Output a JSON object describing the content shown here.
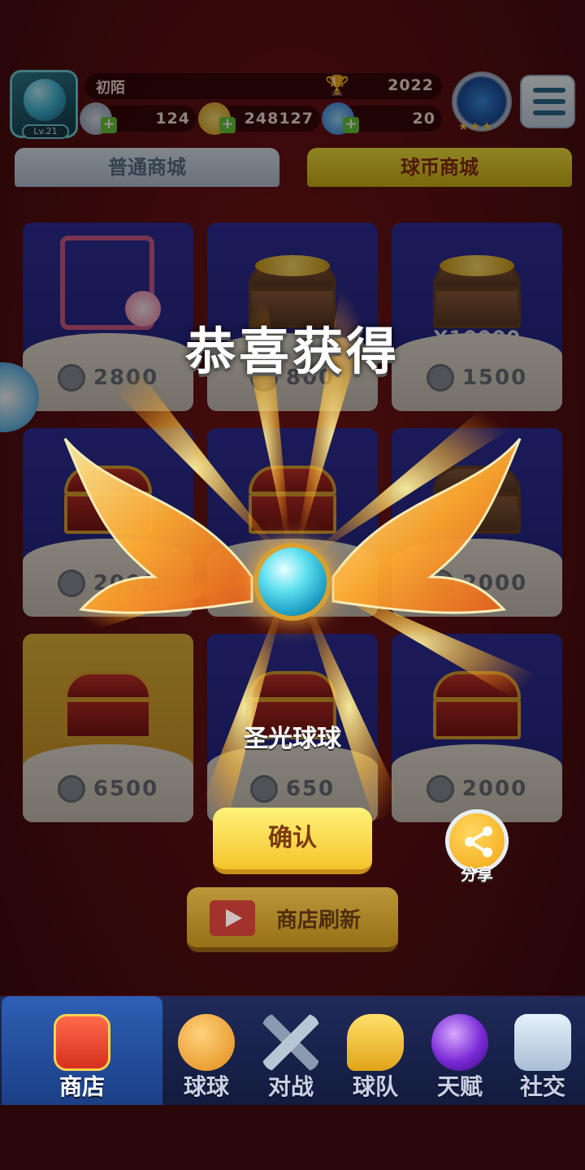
{
  "player": {
    "name": "初陌",
    "level": "Lv.21",
    "trophies": "2022",
    "tickets": "124",
    "coins": "248127",
    "gems": "20"
  },
  "tabs": {
    "normal": "普通商城",
    "coin": "球币商城",
    "active": "coin"
  },
  "shop": {
    "items": [
      {
        "icon": "avatar-frame-icon",
        "price": "2800"
      },
      {
        "icon": "coin-chest-icon",
        "price": "800"
      },
      {
        "icon": "coin-chest-icon",
        "count": "X10000",
        "price": "1500"
      },
      {
        "icon": "treasure-chest-icon",
        "price": "2000"
      },
      {
        "icon": "treasure-chest-icon",
        "price": ""
      },
      {
        "icon": "treasure-chest-icon",
        "price": "2000"
      },
      {
        "icon": "treasure-chest-icon",
        "price": "6500"
      },
      {
        "icon": "treasure-chest-icon",
        "price": "650"
      },
      {
        "icon": "treasure-chest-icon",
        "price": "2000"
      }
    ]
  },
  "reward": {
    "title": "恭喜获得",
    "item_name": "圣光球球",
    "confirm_label": "确认",
    "share_label": "分享"
  },
  "refresh": {
    "label": "商店刷新"
  },
  "nav": {
    "items": [
      {
        "label": "商店",
        "icon": "shop-icon",
        "active": true
      },
      {
        "label": "球球",
        "icon": "ball-icon"
      },
      {
        "label": "对战",
        "icon": "crossed-swords-icon"
      },
      {
        "label": "球队",
        "icon": "whistle-icon"
      },
      {
        "label": "天赋",
        "icon": "planet-icon"
      },
      {
        "label": "社交",
        "icon": "chat-heart-icon"
      }
    ]
  },
  "colors": {
    "background": "#5a0f12",
    "coin_tab": "#f6e640",
    "confirm": "#f4c42a",
    "nav_active": "#2d5fb4"
  }
}
